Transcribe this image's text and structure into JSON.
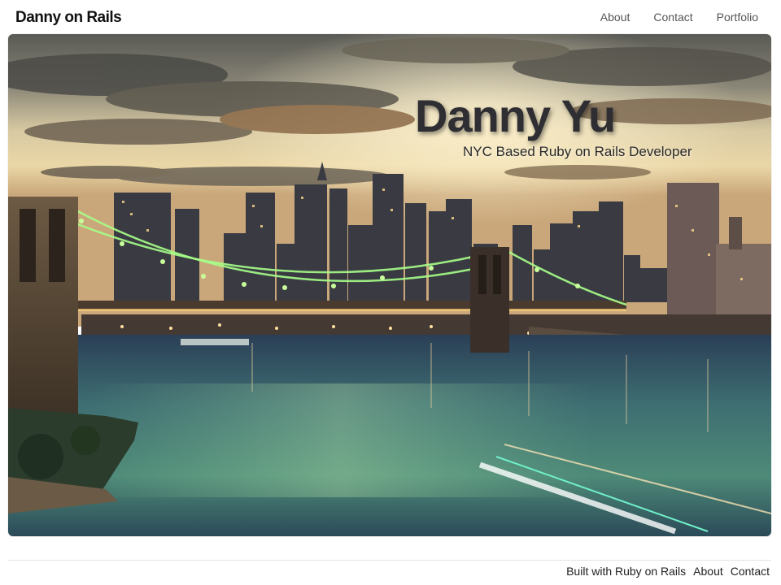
{
  "header": {
    "brand": "Danny on Rails",
    "nav": {
      "about": "About",
      "contact": "Contact",
      "portfolio": "Portfolio"
    }
  },
  "hero": {
    "title": "Danny Yu",
    "subtitle": "NYC Based Ruby on Rails Developer",
    "background_scene": "brooklyn-bridge-manhattan-skyline-at-dusk"
  },
  "footer": {
    "built_with": "Built with Ruby on Rails",
    "about": "About",
    "contact": "Contact"
  },
  "colors": {
    "brand_text": "#111111",
    "nav_text": "#555555",
    "hero_title": "#2e2e33",
    "footer_rule": "#e3e3e3"
  }
}
